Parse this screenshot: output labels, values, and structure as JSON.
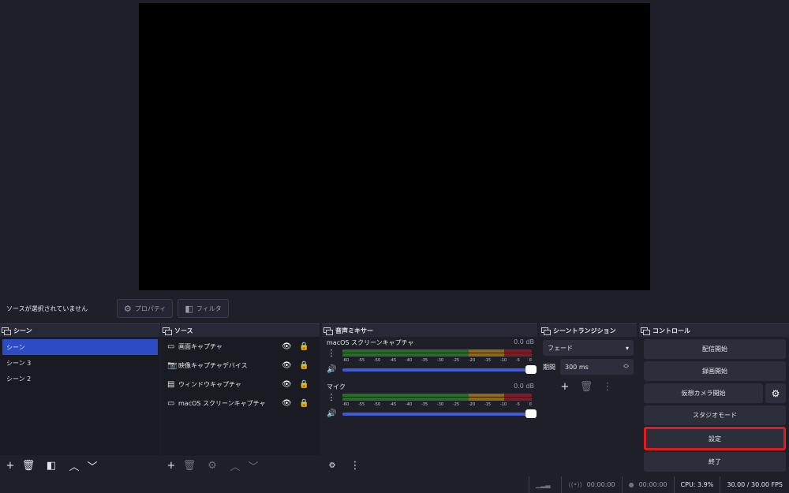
{
  "context": {
    "no_source": "ソースが選択されていません",
    "properties_label": "プロパティ",
    "filters_label": "フィルタ"
  },
  "scenes": {
    "title": "シーン",
    "items": [
      "シーン",
      "シーン 3",
      "シーン 2"
    ]
  },
  "sources": {
    "title": "ソース",
    "items": [
      {
        "label": "画面キャプチャ"
      },
      {
        "label": "映像キャプチャデバイス"
      },
      {
        "label": "ウィンドウキャプチャ"
      },
      {
        "label": "macOS スクリーンキャプチャ"
      }
    ]
  },
  "mixer": {
    "title": "音声ミキサー",
    "ticks": [
      "-60",
      "-55",
      "-50",
      "-45",
      "-40",
      "-35",
      "-30",
      "-25",
      "-20",
      "-15",
      "-10",
      "-5",
      "0"
    ],
    "channels": [
      {
        "name": "macOS スクリーンキャプチャ",
        "db": "0.0 dB"
      },
      {
        "name": "マイク",
        "db": "0.0 dB"
      }
    ]
  },
  "transitions": {
    "title": "シーントランジション",
    "selected": "フェード",
    "duration_label": "期間",
    "duration_value": "300 ms"
  },
  "controls": {
    "title": "コントロール",
    "start_streaming": "配信開始",
    "start_recording": "録画開始",
    "start_virtual_camera": "仮想カメラ開始",
    "studio_mode": "スタジオモード",
    "settings": "設定",
    "exit": "終了"
  },
  "status": {
    "stream_time": "00:00:00",
    "record_time": "00:00:00",
    "cpu": "CPU: 3.9%",
    "fps": "30.00 / 30.00 FPS"
  },
  "colors": {
    "selected": "#2e4bc6",
    "highlight": "#e01c1c",
    "meter_green": "#2b6a2b",
    "meter_yellow": "#8a6a1a",
    "meter_red": "#7a1d2a",
    "slider": "#3d5bd8"
  }
}
